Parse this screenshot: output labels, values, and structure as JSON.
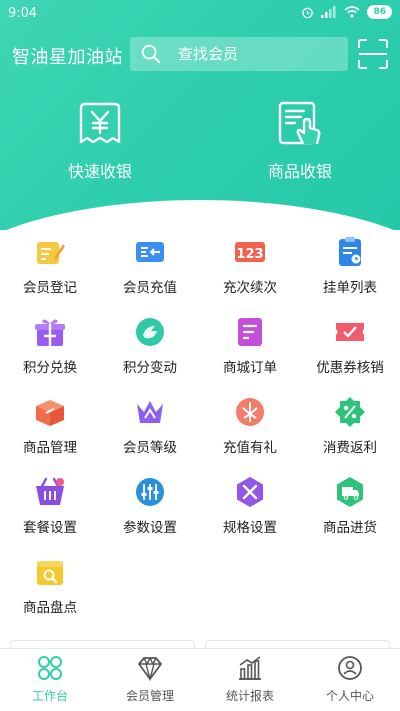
{
  "status_bar": {
    "time": "9:04",
    "battery": "86"
  },
  "header": {
    "station_name": "智油星加油站",
    "search_placeholder": "查找会员"
  },
  "quick_actions": [
    {
      "label": "快速收银",
      "icon": "yuan-receipt-icon"
    },
    {
      "label": "商品收银",
      "icon": "product-checkout-icon"
    }
  ],
  "grid": [
    {
      "label": "会员登记",
      "icon": "pencil-card-icon"
    },
    {
      "label": "会员充值",
      "icon": "card-recharge-icon"
    },
    {
      "label": "充次续次",
      "icon": "count-recharge-icon"
    },
    {
      "label": "挂单列表",
      "icon": "pending-list-icon"
    },
    {
      "label": "积分兑换",
      "icon": "gift-icon"
    },
    {
      "label": "积分变动",
      "icon": "points-change-icon"
    },
    {
      "label": "商城订单",
      "icon": "mall-order-icon"
    },
    {
      "label": "优惠券核销",
      "icon": "coupon-check-icon"
    },
    {
      "label": "商品管理",
      "icon": "box-icon"
    },
    {
      "label": "会员等级",
      "icon": "crown-icon"
    },
    {
      "label": "充值有礼",
      "icon": "recharge-gift-icon"
    },
    {
      "label": "消费返利",
      "icon": "percent-badge-icon"
    },
    {
      "label": "套餐设置",
      "icon": "basket-icon"
    },
    {
      "label": "参数设置",
      "icon": "sliders-icon"
    },
    {
      "label": "规格设置",
      "icon": "tools-icon"
    },
    {
      "label": "商品进货",
      "icon": "truck-icon"
    },
    {
      "label": "商品盘点",
      "icon": "inventory-search-icon"
    }
  ],
  "tabs": [
    {
      "label": "工作台",
      "icon": "workbench-icon",
      "active": true
    },
    {
      "label": "会员管理",
      "icon": "diamond-icon",
      "active": false
    },
    {
      "label": "统计报表",
      "icon": "bar-chart-icon",
      "active": false
    },
    {
      "label": "个人中心",
      "icon": "person-icon",
      "active": false
    }
  ],
  "colors": {
    "brand": "#2fcfae",
    "brand_light": "#3fd6b4",
    "text": "#222222",
    "inactive": "#555555"
  }
}
